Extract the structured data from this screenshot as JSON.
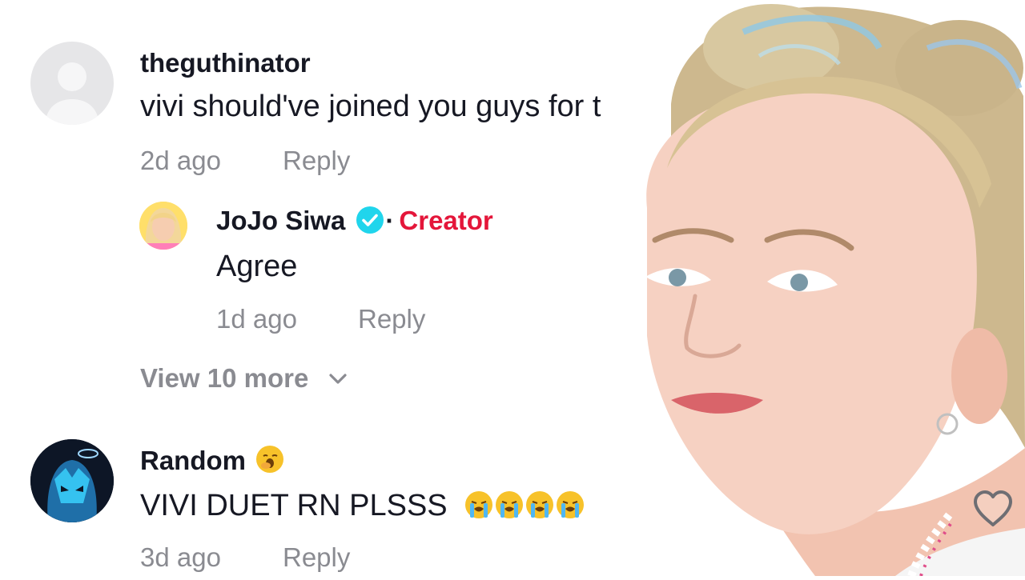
{
  "comments": [
    {
      "username": "theguthinator",
      "text": "vivi should've joined you guys for t",
      "time": "2d ago",
      "reply_label": "Reply",
      "avatar_icon": "default-avatar-icon"
    },
    {
      "username": "JoJo Siwa",
      "creator_label": "Creator",
      "dot": "·",
      "text": "Agree",
      "time": "1d ago",
      "reply_label": "Reply",
      "verified_icon": "verified-check-icon"
    },
    {
      "username": "Random",
      "username_emoji": "yawning-face-emoji",
      "text": "VIVI DUET RN PLSSS",
      "text_emoji": "loudly-crying-face-emoji",
      "text_emoji_count": 4,
      "time": "3d ago",
      "reply_label": "Reply"
    }
  ],
  "view_more_label": "View 10 more",
  "icons": {
    "chevron": "chevron-down-icon",
    "like": "heart-outline-icon"
  },
  "colors": {
    "creator": "#e4163a",
    "verified": "#20d5ec",
    "meta_text": "#8a8b91"
  }
}
